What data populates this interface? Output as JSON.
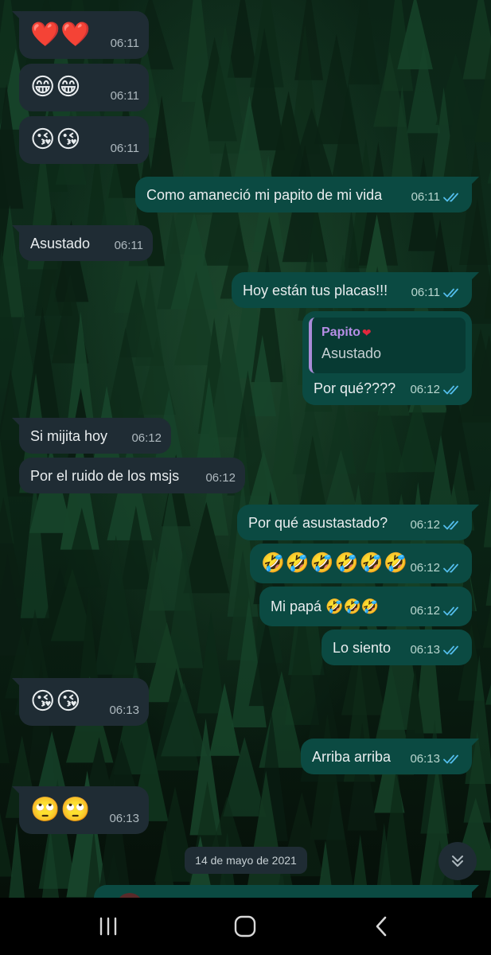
{
  "messages": [
    {
      "dir": "in",
      "content": "❤️❤️",
      "emoji": true,
      "time": "06:11"
    },
    {
      "dir": "in",
      "content": "😁😁",
      "emoji": true,
      "time": "06:11"
    },
    {
      "dir": "in",
      "content": "😘😘",
      "emoji": true,
      "time": "06:11"
    },
    {
      "dir": "out",
      "content": "Como amaneció mi papito de mi vida",
      "time": "06:11",
      "read": true
    },
    {
      "dir": "in",
      "content": "Asustado",
      "time": "06:11"
    },
    {
      "dir": "out",
      "content": "Hoy están tus placas!!!",
      "time": "06:11",
      "read": true
    },
    {
      "dir": "out",
      "content": "Por qué????",
      "time": "06:12",
      "read": true,
      "quote": {
        "author": "Papito",
        "author_emoji": "❤",
        "text": "Asustado"
      }
    },
    {
      "dir": "in",
      "content": "Si mijita hoy",
      "time": "06:12"
    },
    {
      "dir": "in",
      "content": "Por el ruido de los msjs",
      "time": "06:12"
    },
    {
      "dir": "out",
      "content": "Por qué asustastado?",
      "time": "06:12",
      "read": true
    },
    {
      "dir": "out",
      "content": "🤣🤣🤣🤣🤣🤣",
      "emoji": true,
      "time": "06:12",
      "read": true
    },
    {
      "dir": "out",
      "content": "Mi papá 🤣🤣🤣",
      "time": "06:12",
      "read": true
    },
    {
      "dir": "out",
      "content": "Lo siento",
      "time": "06:13",
      "read": true
    },
    {
      "dir": "in",
      "content": "😘😘",
      "emoji": true,
      "time": "06:13"
    },
    {
      "dir": "out",
      "content": "Arriba arriba",
      "time": "06:13",
      "read": true
    },
    {
      "dir": "in",
      "content": "🙄🙄",
      "emoji": true,
      "time": "06:13"
    }
  ],
  "date_separator": "14 de mayo de 2021",
  "icons": {
    "read_receipt": "double-check-icon",
    "scroll_down": "chevrons-down-icon",
    "nav_recents": "recents-icon",
    "nav_home": "home-icon",
    "nav_back": "back-icon"
  },
  "colors": {
    "incoming_bubble": "#1f2c34",
    "outgoing_bubble": "#0b4a42",
    "read_ticks": "#53bdeb",
    "quote_author": "#b68ee6"
  }
}
